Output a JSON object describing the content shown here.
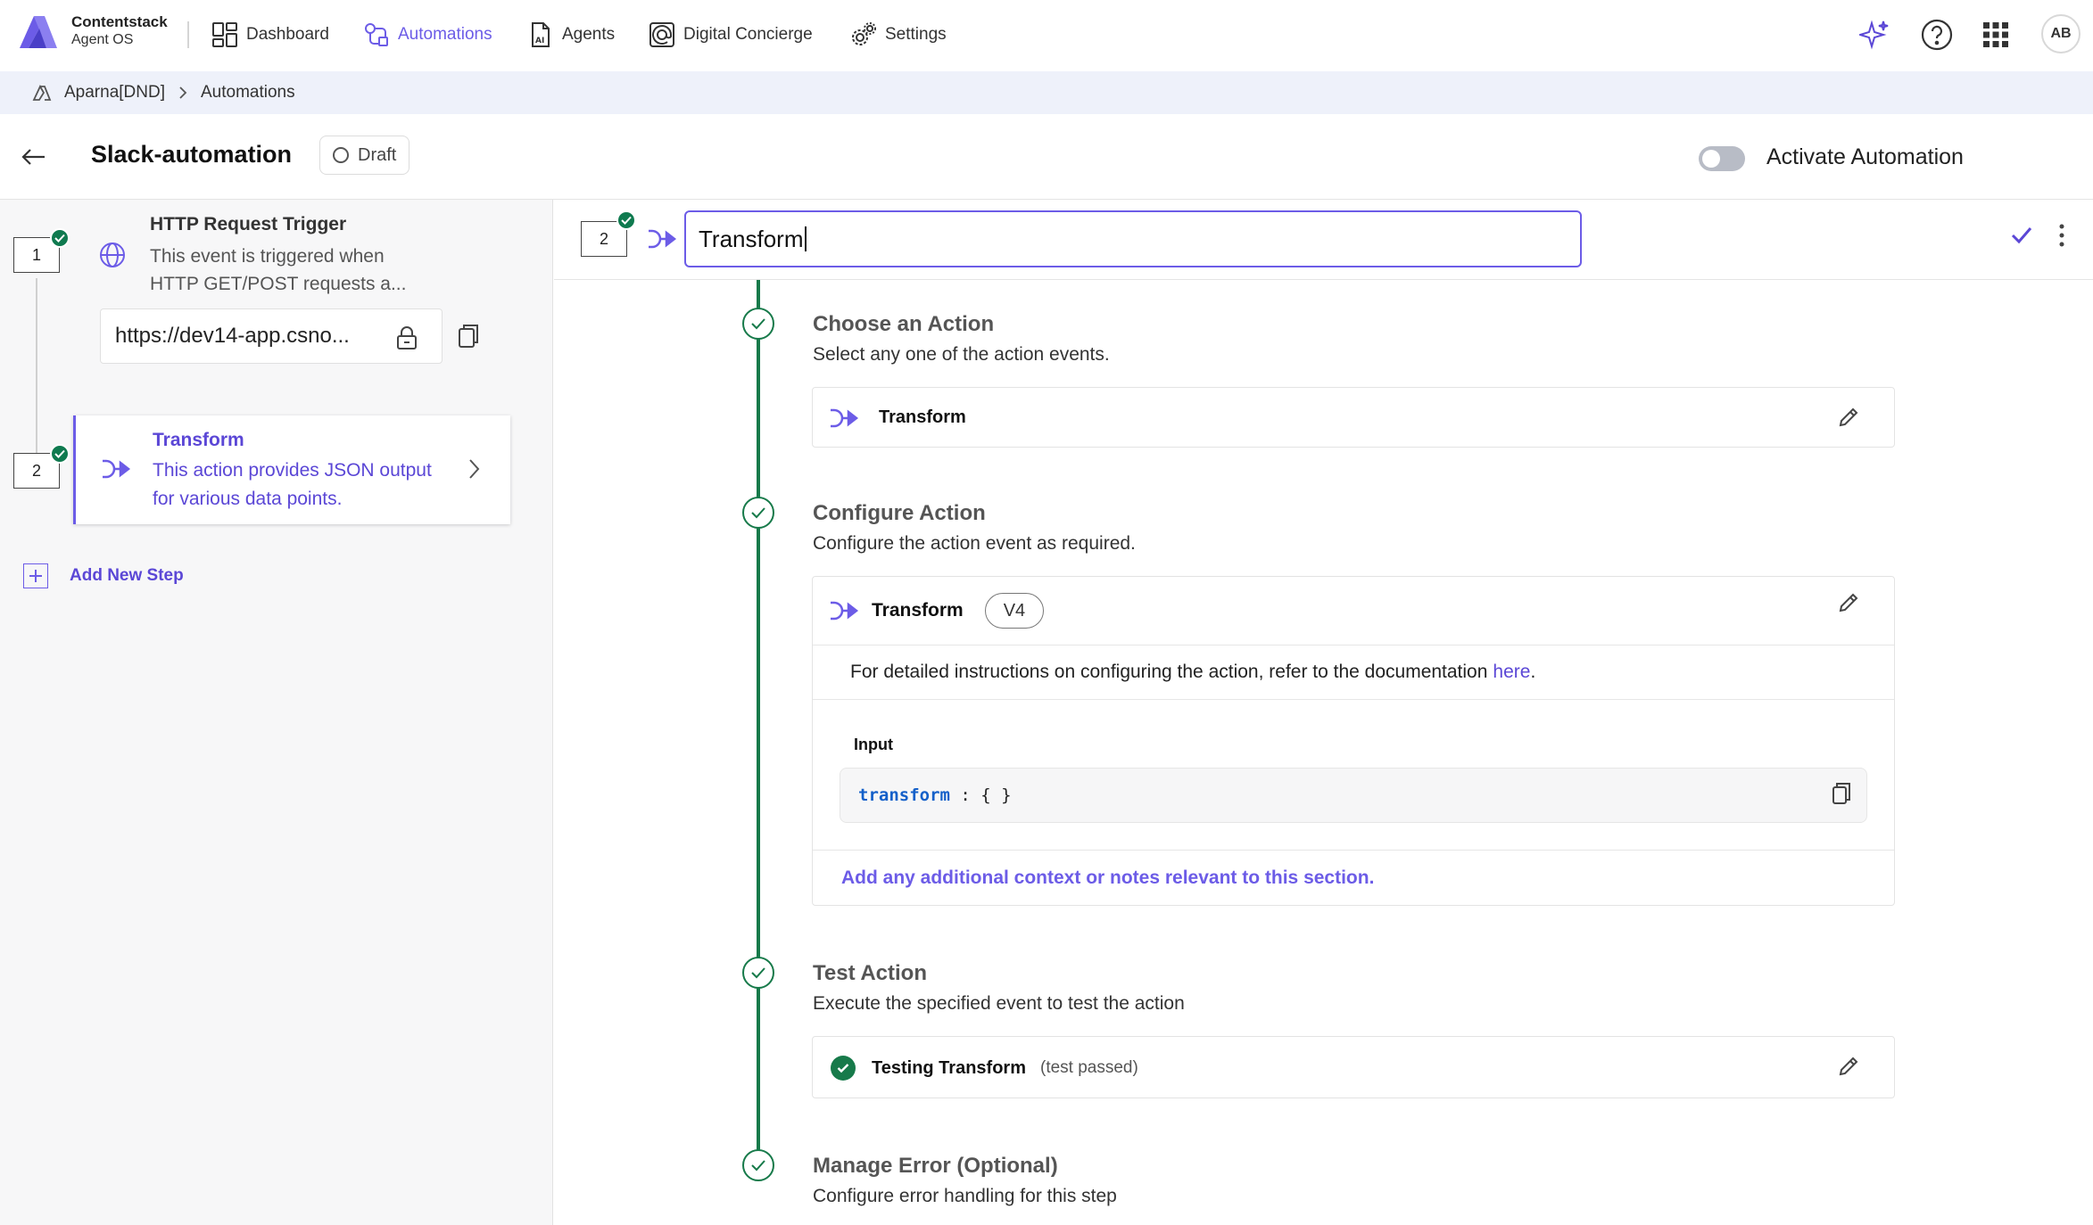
{
  "brand": {
    "name": "Contentstack",
    "product": "Agent OS"
  },
  "nav": {
    "items": [
      {
        "label": "Dashboard",
        "icon": "dashboard-icon"
      },
      {
        "label": "Automations",
        "icon": "automations-icon",
        "active": true
      },
      {
        "label": "Agents",
        "icon": "agents-icon"
      },
      {
        "label": "Digital Concierge",
        "icon": "concierge-icon"
      },
      {
        "label": "Settings",
        "icon": "settings-icon"
      }
    ],
    "avatar": "AB"
  },
  "breadcrumb": {
    "org": "Aparna[DND]",
    "page": "Automations"
  },
  "header": {
    "title": "Slack-automation",
    "status": "Draft",
    "activate_label": "Activate Automation",
    "activated": false
  },
  "steps": {
    "trigger": {
      "number": "1",
      "title": "HTTP Request Trigger",
      "description": "This event is triggered when HTTP GET/POST requests a...",
      "url": "https://dev14-app.csno..."
    },
    "action": {
      "number": "2",
      "title": "Transform",
      "description": "This action provides JSON output for various data points."
    },
    "add_label": "Add New Step"
  },
  "editor": {
    "step_number": "2",
    "name_value": "Transform",
    "choose": {
      "title": "Choose an Action",
      "desc": "Select any one of the action events.",
      "selected": "Transform"
    },
    "configure": {
      "title": "Configure Action",
      "desc": "Configure the action event as required.",
      "action": "Transform",
      "version": "V4",
      "doc_text": "For detailed instructions on configuring the action, refer to the documentation ",
      "doc_link": "here",
      "doc_end": ".",
      "input_label": "Input",
      "code_key": "transform",
      "code_rest": " : { }",
      "notes": "Add any additional context or notes relevant to this section."
    },
    "test": {
      "title": "Test Action",
      "desc": "Execute the specified event to test the action",
      "label": "Testing Transform",
      "status": "(test passed)"
    },
    "error": {
      "title": "Manage Error (Optional)",
      "desc": "Configure error handling for this step"
    }
  },
  "colors": {
    "accent": "#6c5ce7",
    "success": "#177a4a",
    "breadcrumb_bg": "#eef1fa"
  }
}
